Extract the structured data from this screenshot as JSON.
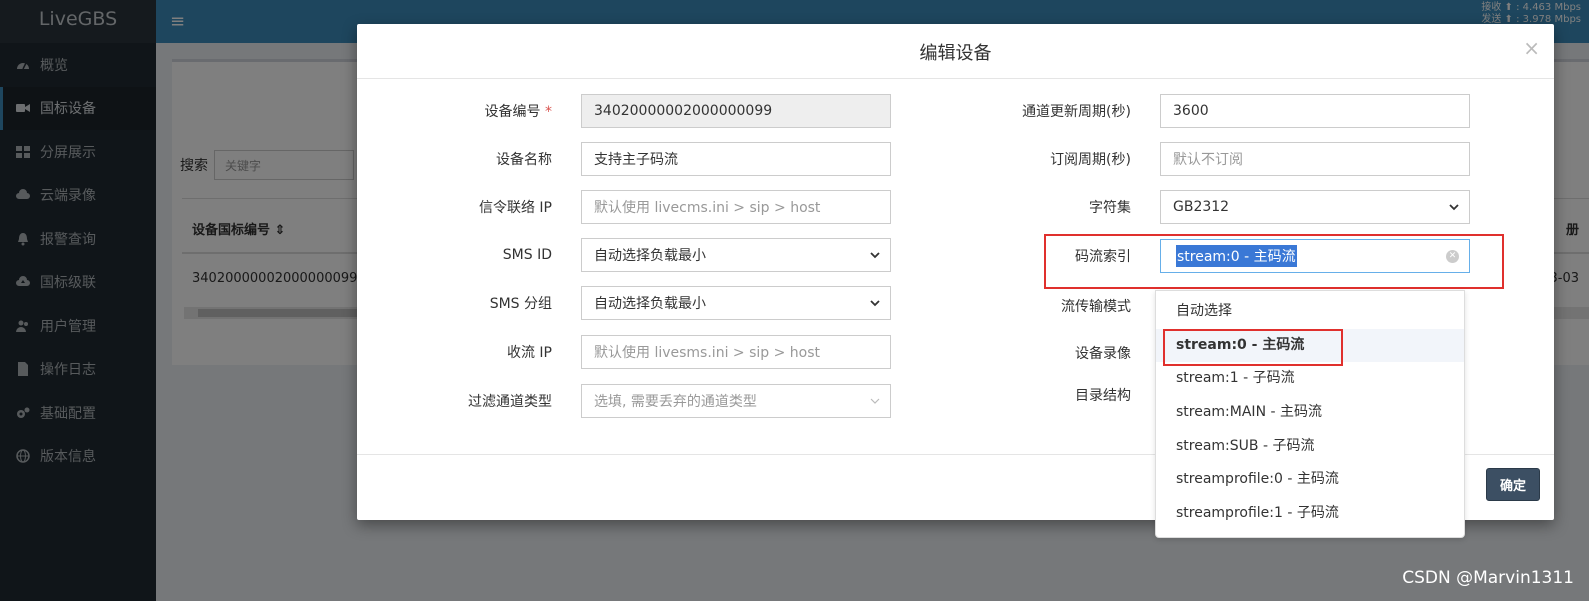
{
  "app": {
    "brand": "LiveGBS",
    "net_stats": [
      "接收 ⬆ : 4.463 Mbps",
      "发送 ⬆ : 3.978 Mbps"
    ]
  },
  "sidebar": {
    "items": [
      {
        "label": "概览",
        "icon": "dashboard-icon"
      },
      {
        "label": "国标设备",
        "icon": "video-camera-icon"
      },
      {
        "label": "分屏展示",
        "icon": "grid-icon"
      },
      {
        "label": "云端录像",
        "icon": "cloud-icon"
      },
      {
        "label": "报警查询",
        "icon": "bell-icon"
      },
      {
        "label": "国标级联",
        "icon": "cloud-upload-icon"
      },
      {
        "label": "用户管理",
        "icon": "users-icon"
      },
      {
        "label": "操作日志",
        "icon": "file-icon"
      },
      {
        "label": "基础配置",
        "icon": "gears-icon"
      },
      {
        "label": "版本信息",
        "icon": "globe-icon"
      }
    ]
  },
  "background_page": {
    "search_label": "搜索",
    "search_placeholder": "关键字",
    "col_device_id": "设备国标编号 ⇕",
    "col_right_fragment": "册",
    "row_device_id": "34020000002000000099",
    "row_right_fragment": "3-03"
  },
  "modal": {
    "title": "编辑设备",
    "close": "×",
    "confirm_label": "确定",
    "left_fields": [
      {
        "label": "设备编号",
        "required": "*",
        "value": "34020000002000000099",
        "kind": "disabled"
      },
      {
        "label": "设备名称",
        "value": "支持主子码流",
        "kind": "input"
      },
      {
        "label": "信令联络 IP",
        "value": "默认使用 livecms.ini > sip > host",
        "kind": "placeholder"
      },
      {
        "label": "SMS ID",
        "value": "自动选择负载最小",
        "kind": "select"
      },
      {
        "label": "SMS 分组",
        "value": "自动选择负载最小",
        "kind": "select"
      },
      {
        "label": "收流 IP",
        "value": "默认使用 livesms.ini > sip > host",
        "kind": "placeholder"
      },
      {
        "label": "过滤通道类型",
        "value": "选填, 需要丢弃的通道类型",
        "kind": "placeholder-select"
      }
    ],
    "right_fields": [
      {
        "label": "通道更新周期(秒)",
        "value": "3600",
        "kind": "input"
      },
      {
        "label": "订阅周期(秒)",
        "value": "默认不订阅",
        "kind": "placeholder"
      },
      {
        "label": "字符集",
        "value": "GB2312",
        "kind": "select"
      },
      {
        "label": "码流索引",
        "value": "stream:0 - 主码流",
        "kind": "highlight"
      },
      {
        "label": "流传输模式"
      },
      {
        "label": "设备录像"
      },
      {
        "label": "目录结构"
      }
    ],
    "stream_dropdown": {
      "options": [
        "自动选择",
        "stream:0 - 主码流",
        "stream:1 - 子码流",
        "stream:MAIN - 主码流",
        "stream:SUB - 子码流",
        "streamprofile:0 - 主码流",
        "streamprofile:1 - 子码流"
      ],
      "selected_index": 1
    }
  },
  "watermark": "CSDN @Marvin1311"
}
